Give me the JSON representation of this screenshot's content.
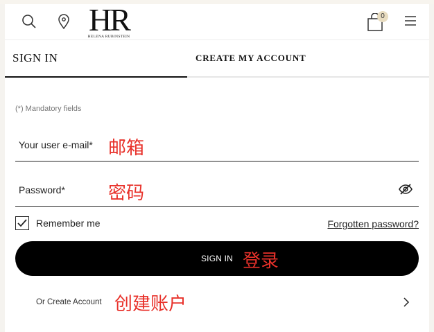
{
  "header": {
    "logo_monogram": "HR",
    "logo_brand": "HELENA RUBINSTEIN",
    "cart_count": "0",
    "icons": [
      "search-icon",
      "location-pin-icon",
      "shopping-bag-icon",
      "hamburger-menu-icon"
    ]
  },
  "tabs": [
    {
      "label": "SIGN IN",
      "active": true
    },
    {
      "label": "CREATE MY ACCOUNT",
      "active": false
    }
  ],
  "form": {
    "mandatory_note": "(*) Mandatory fields",
    "email_label": "Your user e-mail*",
    "email_annotation": "邮箱",
    "password_label": "Password*",
    "password_annotation": "密码",
    "remember_label": "Remember me",
    "remember_checked": true,
    "forgot_link": "Forgotten password?",
    "signin_button": "SIGN IN",
    "signin_annotation": "登录",
    "create_link": "Or Create Account",
    "create_annotation": "创建账户"
  },
  "colors": {
    "annotation": "#e8312a",
    "button_bg": "#000000",
    "badge_bg": "#e8dcc0"
  }
}
